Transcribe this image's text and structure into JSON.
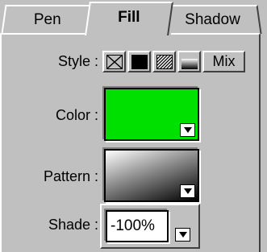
{
  "tabs": [
    {
      "label": "Pen"
    },
    {
      "label": "Fill"
    },
    {
      "label": "Shadow"
    }
  ],
  "style": {
    "label": "Style :",
    "buttons": [
      {
        "icon": "x-cross-icon"
      },
      {
        "icon": "solid-fill-icon"
      },
      {
        "icon": "hatch-pattern-icon"
      },
      {
        "icon": "gradient-icon"
      },
      {
        "label": "Mix"
      }
    ]
  },
  "color": {
    "label": "Color :",
    "value": "#00e000"
  },
  "pattern": {
    "label": "Pattern :"
  },
  "shade": {
    "label": "Shade :",
    "value": "-100%"
  },
  "colors": {
    "face": "#c0c0c0",
    "highlight": "#ffffff",
    "shadow": "#404040"
  }
}
